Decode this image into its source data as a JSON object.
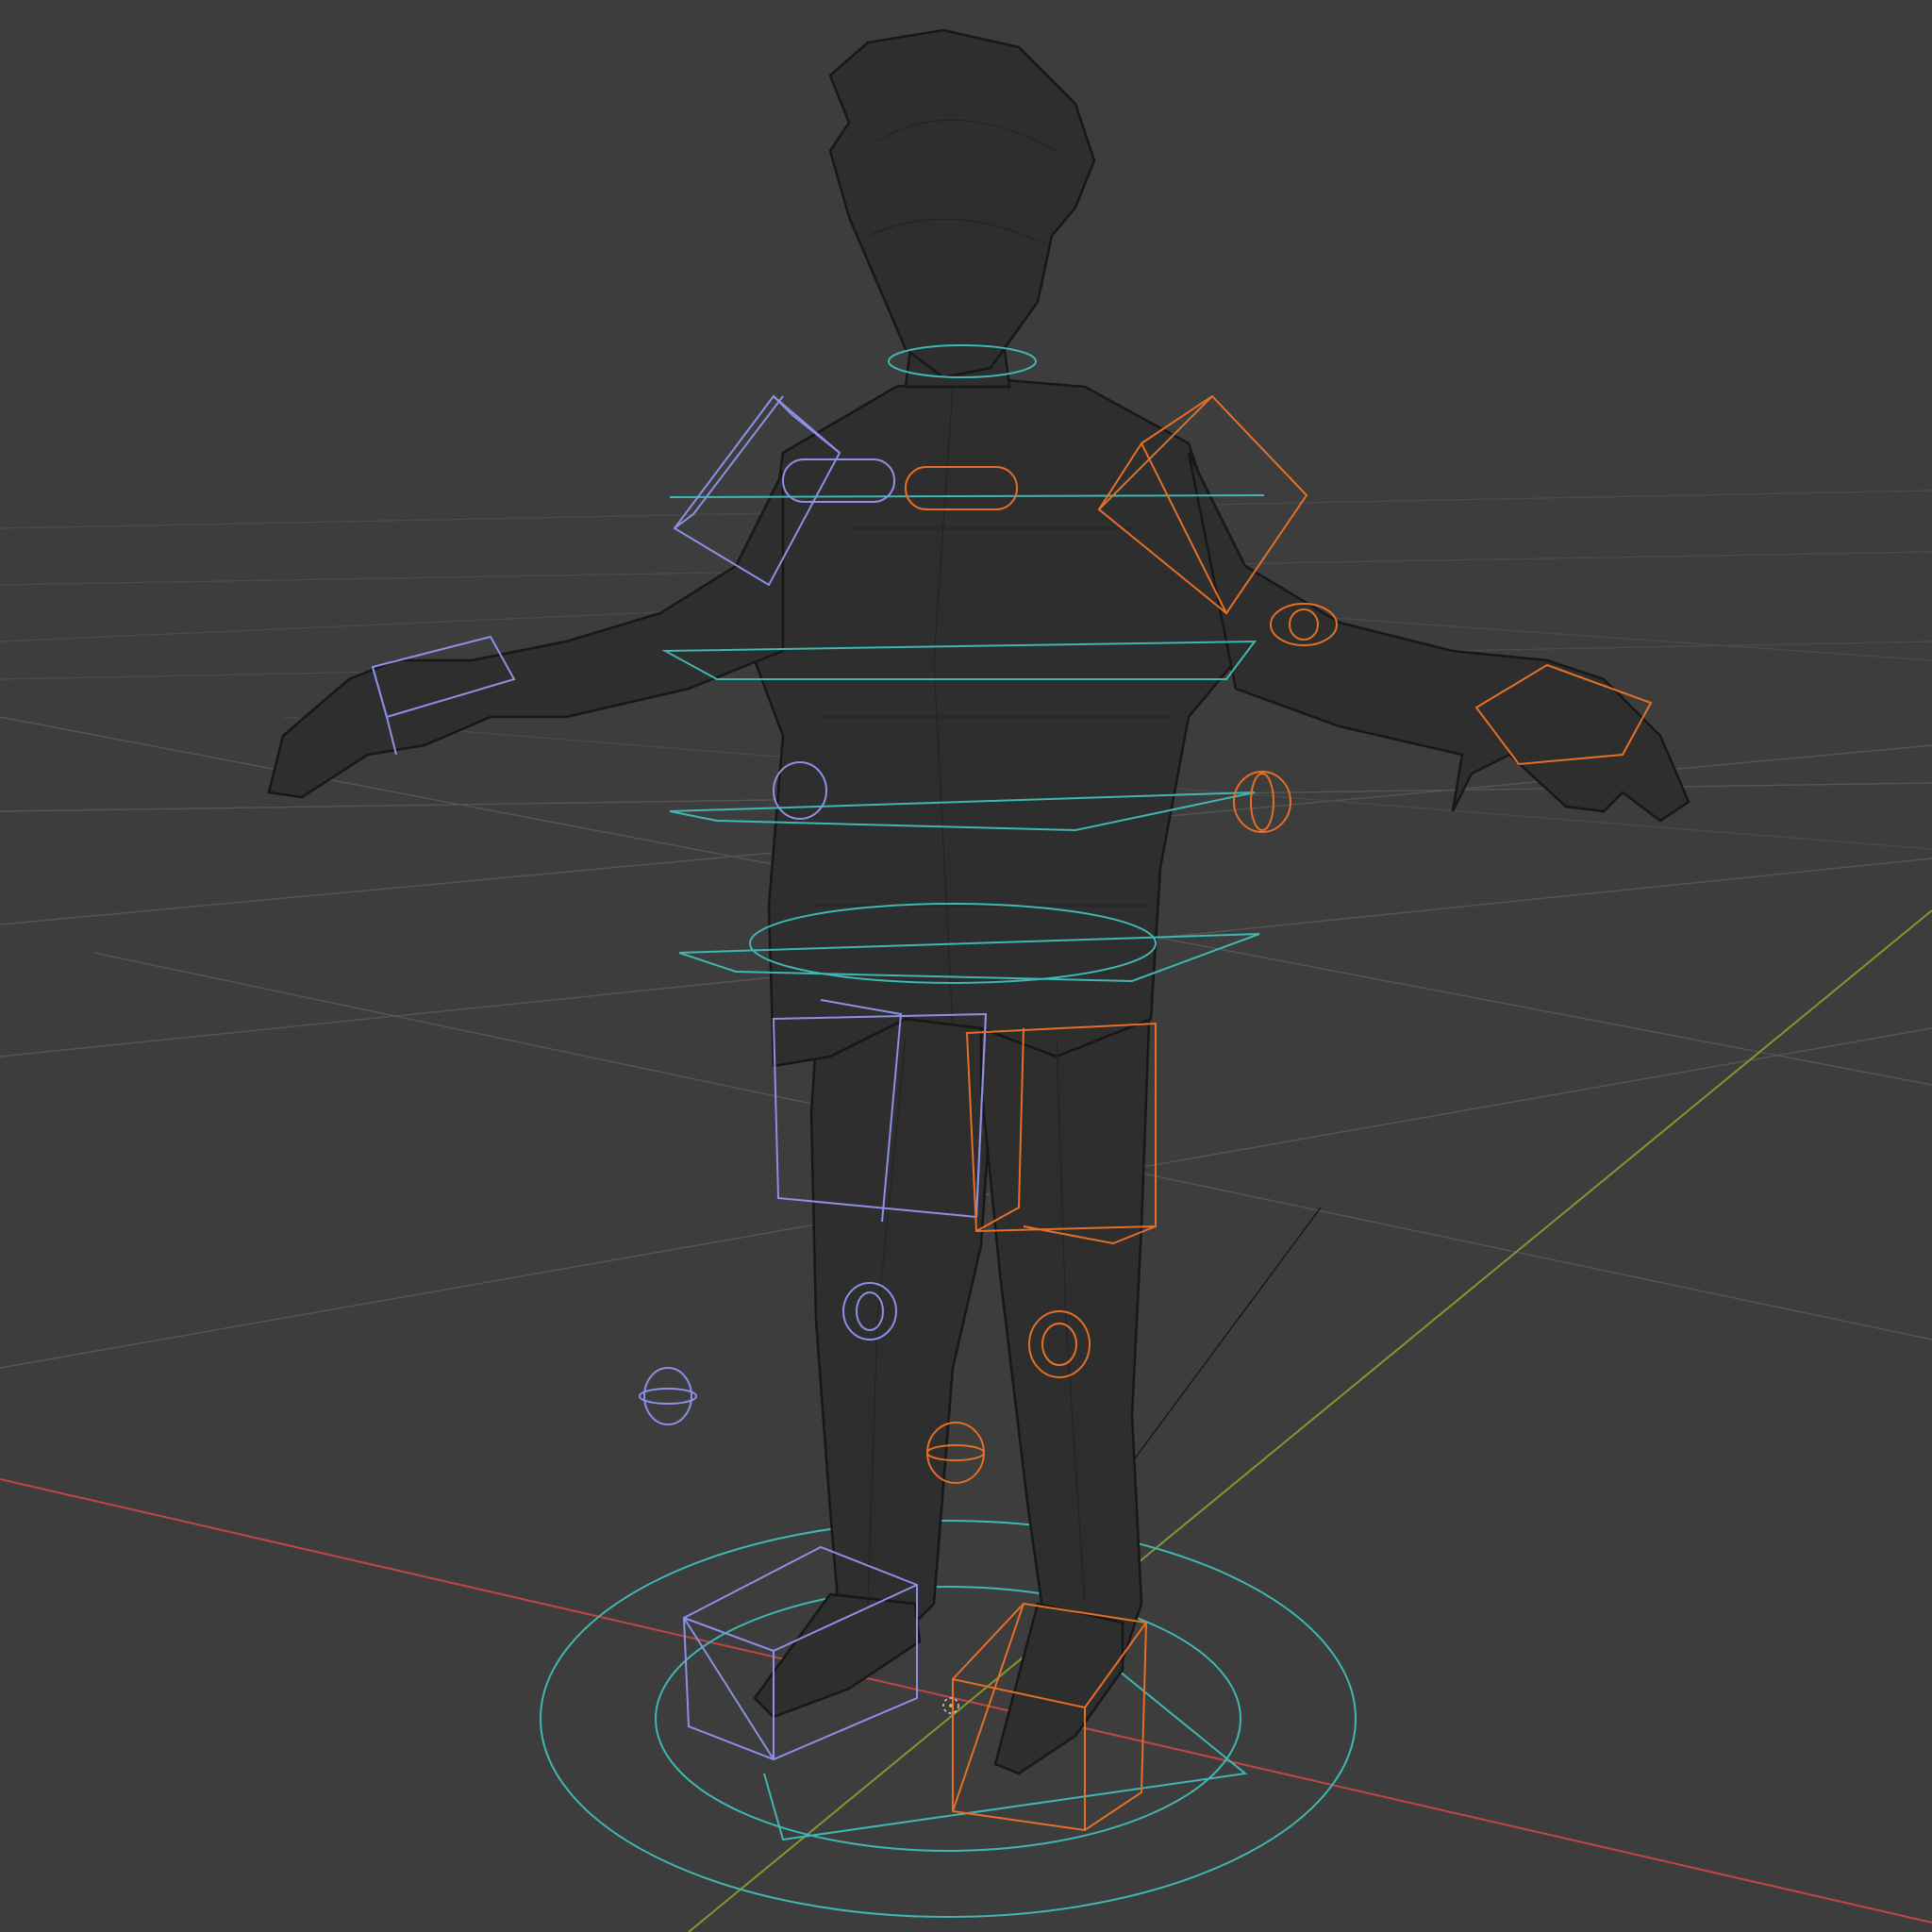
{
  "viewport": {
    "background_color": "#3d3d3d",
    "grid_color": "#4a4a4a",
    "x_axis_color": "#c24545",
    "y_axis_color": "#7e9a2c",
    "mesh_wire_color": "#171717",
    "left_control_color": "#8c90e6",
    "right_control_color": "#e66f26",
    "center_control_color": "#3fb7b2"
  }
}
